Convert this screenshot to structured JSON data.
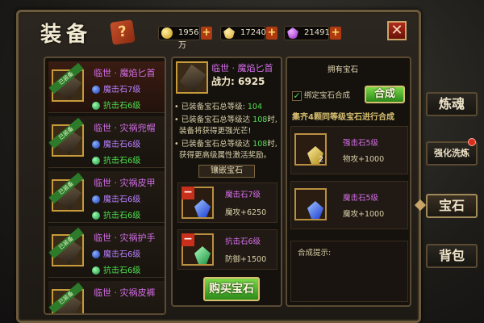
{
  "title": "装备",
  "resources": [
    {
      "icon": "gold-coin-icon",
      "value": "1956万"
    },
    {
      "icon": "yellow-diamond-icon",
      "value": "17240"
    },
    {
      "icon": "purple-diamond-icon",
      "value": "21491"
    }
  ],
  "equipment_list": [
    {
      "name": "临世 · 魔焰匕首",
      "ribbon": "已装备",
      "gems": [
        {
          "icon": "blue-gem-icon",
          "label": "魔击石7级"
        },
        {
          "icon": "green-gem-icon",
          "label": "抗击石6级"
        }
      ]
    },
    {
      "name": "临世 · 灾祸兜帽",
      "ribbon": "已装备",
      "gems": [
        {
          "icon": "blue-gem-icon",
          "label": "魔击石6级"
        },
        {
          "icon": "green-gem-icon",
          "label": "抗击石6级"
        }
      ]
    },
    {
      "name": "临世 · 灾祸皮甲",
      "ribbon": "已装备",
      "gems": [
        {
          "icon": "blue-gem-icon",
          "label": "魔击石6级"
        },
        {
          "icon": "green-gem-icon",
          "label": "抗击石6级"
        }
      ]
    },
    {
      "name": "临世 · 灾祸护手",
      "ribbon": "已装备",
      "gems": [
        {
          "icon": "blue-gem-icon",
          "label": "魔击石6级"
        },
        {
          "icon": "green-gem-icon",
          "label": "抗击石6级"
        }
      ]
    },
    {
      "name": "临世 · 灾祸皮裤",
      "ribbon": "已装备",
      "gems": []
    }
  ],
  "detail": {
    "name": "临世 · 魔焰匕首",
    "power_label": "战力:",
    "power_value": "6925",
    "line1_pre": "• 已装备宝石总等级:",
    "line1_val": "104",
    "line2_pre": "• 已装备宝石总等级达",
    "line2_val": "108",
    "line2_post": "时,",
    "line3": "装备将获得更强光芒!",
    "line4_pre": "• 已装备宝石总等级达",
    "line4_val": "108",
    "line4_post": "时,",
    "line5": "获得更高级属性激活奖励。",
    "inlay_label": "镶嵌宝石",
    "slots": [
      {
        "name": "魔击石7级",
        "attr": "魔攻+6250"
      },
      {
        "name": "抗击石6级",
        "attr": "防御+1500"
      }
    ],
    "buy_label": "购买宝石"
  },
  "owned": {
    "header": "拥有宝石",
    "bind_label": "绑定宝石合成",
    "bind_checked": true,
    "combine_label": "合成",
    "rule": "集齐4颗同等级宝石进行合成",
    "gems": [
      {
        "name": "强击石5级",
        "attr": "物攻+1000",
        "count": "2"
      },
      {
        "name": "魔击石5级",
        "attr": "魔攻+1000",
        "count": ""
      }
    ],
    "hint_label": "合成提示:"
  },
  "tabs": [
    {
      "label": "炼魂",
      "active": false
    },
    {
      "label": "强化洗炼",
      "active": false
    },
    {
      "label": "宝石",
      "active": true
    },
    {
      "label": "背包",
      "active": false
    }
  ],
  "close_symbol": "✕",
  "colors": {
    "accent_purple": "#d46ee8",
    "accent_green": "#4ee04e",
    "gold": "#ffd37a"
  }
}
